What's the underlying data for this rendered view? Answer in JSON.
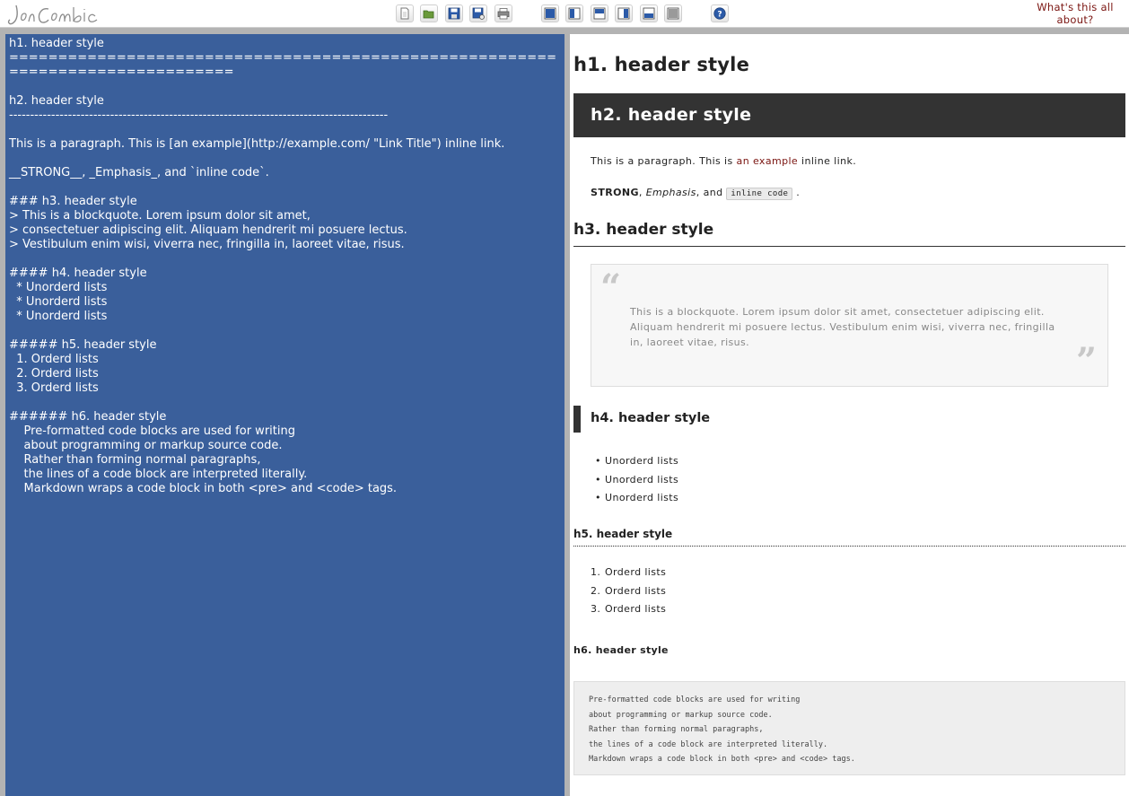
{
  "app": {
    "logo_text": "JonCombe",
    "about_link": "What's this all about?"
  },
  "toolbar": {
    "buttons": [
      {
        "name": "new-document-button",
        "icon": "new-document-icon"
      },
      {
        "name": "open-button",
        "icon": "folder-open-icon"
      },
      {
        "name": "save-button",
        "icon": "save-icon"
      },
      {
        "name": "save-as-button",
        "icon": "save-as-icon"
      },
      {
        "name": "print-button",
        "icon": "printer-icon"
      },
      {
        "name": "layout-editor-only-button",
        "icon": "layout-editor-only-icon"
      },
      {
        "name": "layout-side-by-side-button",
        "icon": "layout-side-by-side-icon"
      },
      {
        "name": "layout-top-bottom-button",
        "icon": "layout-top-bottom-icon"
      },
      {
        "name": "layout-split-vertical-button",
        "icon": "layout-split-vertical-icon"
      },
      {
        "name": "layout-split-horizontal-button",
        "icon": "layout-split-horizontal-icon"
      },
      {
        "name": "layout-preview-only-button",
        "icon": "layout-preview-only-icon"
      },
      {
        "name": "help-button",
        "icon": "help-icon"
      }
    ]
  },
  "editor": {
    "source": "h1. header style\n===============================================================================\n\nh2. header style\n------------------------------------------------------------------------------------------\n\nThis is a paragraph. This is [an example](http://example.com/ \"Link Title\") inline link.\n\n__STRONG__, _Emphasis_, and `inline code`.\n\n### h3. header style\n> This is a blockquote. Lorem ipsum dolor sit amet,\n> consectetuer adipiscing elit. Aliquam hendrerit mi posuere lectus.\n> Vestibulum enim wisi, viverra nec, fringilla in, laoreet vitae, risus.\n\n#### h4. header style\n  * Unorderd lists\n  * Unorderd lists\n  * Unorderd lists\n\n##### h5. header style\n  1. Orderd lists\n  2. Orderd lists\n  3. Orderd lists\n\n###### h6. header style\n    Pre-formatted code blocks are used for writing\n    about programming or markup source code.\n    Rather than forming normal paragraphs,\n    the lines of a code block are interpreted literally.\n    Markdown wraps a code block in both <pre> and <code> tags."
  },
  "preview": {
    "h1": "h1. header style",
    "h2": "h2. header style",
    "paragraph_before": "This is a paragraph. This is ",
    "paragraph_link": "an example",
    "paragraph_after": " inline link.",
    "strong": "STRONG",
    "sep1": ", ",
    "emphasis": "Emphasis",
    "sep2": ", and ",
    "inline_code": "inline code",
    "sep3": ".",
    "h3": "h3. header style",
    "blockquote": "This is a blockquote. Lorem ipsum dolor sit amet, consectetuer adipiscing elit. Aliquam hendrerit mi posuere lectus. Vestibulum enim wisi, viverra nec, fringilla in, laoreet vitae, risus.",
    "h4": "h4. header style",
    "unordered_list": [
      "Unorderd lists",
      "Unorderd lists",
      "Unorderd lists"
    ],
    "h5": "h5. header style",
    "ordered_list": [
      "Orderd lists",
      "Orderd lists",
      "Orderd lists"
    ],
    "ordered_numbers": [
      "1.",
      "2.",
      "3."
    ],
    "h6": "h6. header style",
    "code_block": "Pre-formatted code blocks are used for writing\nabout programming or markup source code.\nRather than forming normal paragraphs,\nthe lines of a code block are interpreted literally.\nMarkdown wraps a code block in both <pre> and <code> tags."
  },
  "colors": {
    "editor_bg": "#3a5f9b",
    "link": "#7a1410",
    "header_bar": "#333333"
  }
}
